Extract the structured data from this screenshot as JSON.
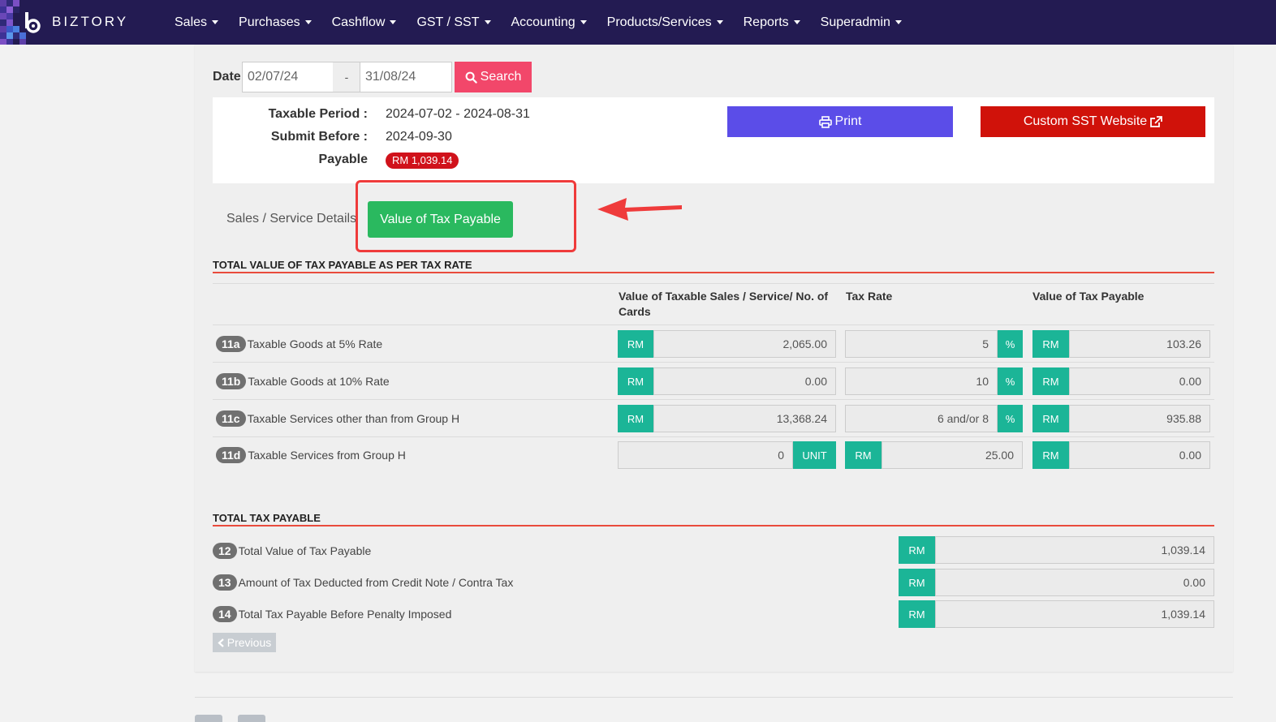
{
  "brand": {
    "name": "BIZTORY"
  },
  "nav": {
    "items": [
      {
        "label": "Sales"
      },
      {
        "label": "Purchases"
      },
      {
        "label": "Cashflow"
      },
      {
        "label": "GST / SST"
      },
      {
        "label": "Accounting"
      },
      {
        "label": "Products/Services"
      },
      {
        "label": "Reports"
      },
      {
        "label": "Superadmin"
      }
    ]
  },
  "filter": {
    "date_label": "Date",
    "from": "02/07/24",
    "separator": "-",
    "to": "31/08/24",
    "search_label": "Search"
  },
  "summary": {
    "period_label": "Taxable Period :",
    "period_value": "2024-07-02 - 2024-08-31",
    "submit_label": "Submit Before :",
    "submit_value": "2024-09-30",
    "payable_label": "Payable",
    "payable_value": "RM 1,039.14",
    "print_label": "Print",
    "custom_label": "Custom SST Website"
  },
  "tabs": {
    "details": "Sales / Service Details",
    "active": "Value of Tax Payable"
  },
  "section1": {
    "title": "TOTAL VALUE OF TAX PAYABLE AS PER TAX RATE",
    "col_value": "Value of Taxable Sales / Service/ No. of Cards",
    "col_rate": "Tax Rate",
    "col_payable": "Value of Tax Payable",
    "rows": [
      {
        "code": "11a",
        "label": "Taxable Goods at 5% Rate",
        "value_prefix": "RM",
        "value": "2,065.00",
        "rate": "5",
        "rate_suffix": "%",
        "payable_prefix": "RM",
        "payable": "103.26"
      },
      {
        "code": "11b",
        "label": "Taxable Goods at 10% Rate",
        "value_prefix": "RM",
        "value": "0.00",
        "rate": "10",
        "rate_suffix": "%",
        "payable_prefix": "RM",
        "payable": "0.00"
      },
      {
        "code": "11c",
        "label": "Taxable Services other than from Group H",
        "value_prefix": "RM",
        "value": "13,368.24",
        "rate": "6 and/or 8",
        "rate_suffix": "%",
        "payable_prefix": "RM",
        "payable": "935.88"
      },
      {
        "code": "11d",
        "label": "Taxable Services from Group H",
        "value": "0",
        "value_suffix": "UNIT",
        "rate_prefix": "RM",
        "rate": "25.00",
        "payable_prefix": "RM",
        "payable": "0.00"
      }
    ]
  },
  "section2": {
    "title": "TOTAL TAX PAYABLE",
    "rows": [
      {
        "code": "12",
        "label": "Total Value of Tax Payable",
        "prefix": "RM",
        "value": "1,039.14"
      },
      {
        "code": "13",
        "label": "Amount of Tax Deducted from Credit Note / Contra Tax",
        "prefix": "RM",
        "value": "0.00"
      },
      {
        "code": "14",
        "label": "Total Tax Payable Before Penalty Imposed",
        "prefix": "RM",
        "value": "1,039.14"
      }
    ]
  },
  "pager": {
    "previous_label": "Previous"
  },
  "colors": {
    "navbar": "#231b52",
    "search": "#f2476a",
    "print": "#5b4de8",
    "custom": "#d0120a",
    "active_tab": "#2ab95f",
    "addon": "#1bb597",
    "annotation": "#ef3b3b"
  }
}
